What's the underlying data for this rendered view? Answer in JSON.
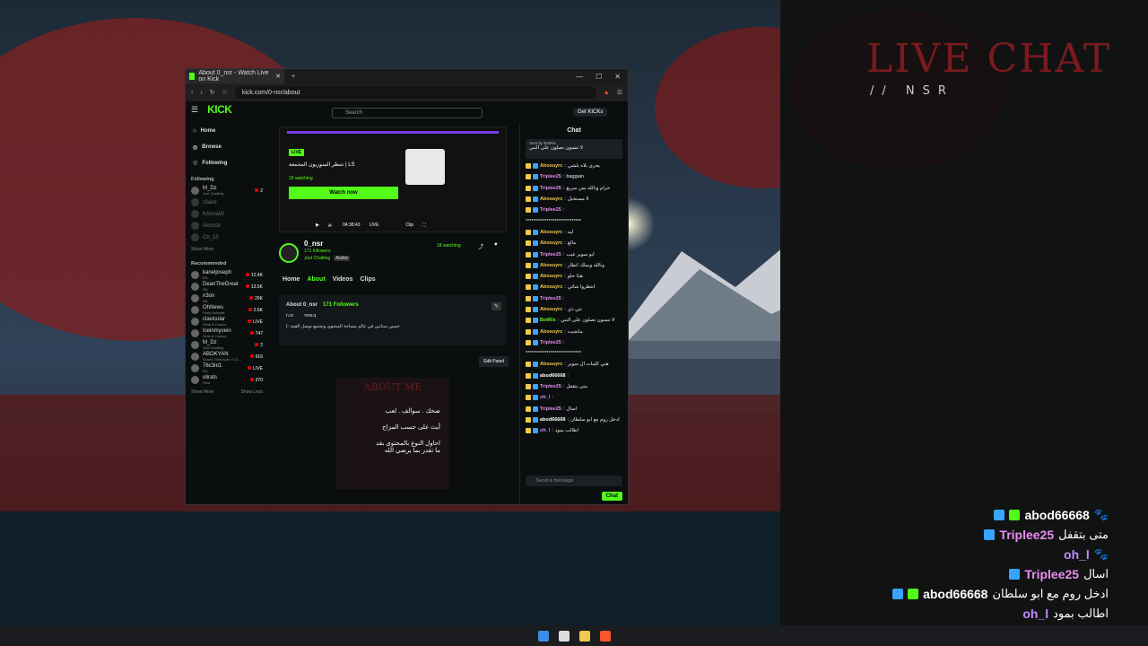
{
  "overlay": {
    "title": "LIVE CHAT",
    "subtitle": "// NSR",
    "messages": [
      {
        "user": "abod66668",
        "text": "🐾",
        "color": "#ffffff",
        "badges": [
          "#3aa3ff",
          "#53fc18"
        ]
      },
      {
        "user": "Triplee25",
        "text": "متى بتقفل",
        "color": "#e88ef0",
        "badges": [
          "#3aa3ff"
        ]
      },
      {
        "user": "oh_l",
        "text": "🐾",
        "color": "#c58af9",
        "badges": []
      },
      {
        "user": "Triplee25",
        "text": "اسال",
        "color": "#e88ef0",
        "badges": [
          "#3aa3ff"
        ]
      },
      {
        "user": "abod66668",
        "text": "ادخل روم مع ابو سلطان",
        "color": "#ffffff",
        "badges": [
          "#3aa3ff",
          "#53fc18"
        ]
      },
      {
        "user": "oh_l",
        "text": "اطالب بمود",
        "color": "#c58af9",
        "badges": []
      }
    ]
  },
  "browser": {
    "tab_title": "About 0_nsr - Watch Live on Kick",
    "new_tab": "+",
    "url": "kick.com/0-nsr/about",
    "minimize": "—",
    "maximize": "☐",
    "close": "✕"
  },
  "kick": {
    "logo": "KICK",
    "search_placeholder": "Search",
    "get_kicks": "Get KICKs",
    "nav": [
      {
        "label": "Home",
        "icon": "home-icon"
      },
      {
        "label": "Browse",
        "icon": "compass-icon"
      },
      {
        "label": "Following",
        "icon": "heart-icon"
      }
    ],
    "following_header": "Following",
    "following": [
      {
        "name": "M_Dz",
        "cat": "Just Chatting",
        "viewers": "2"
      },
      {
        "name": "Ulaire",
        "cat": "",
        "viewers": ""
      },
      {
        "name": "KAnnaW",
        "cat": "",
        "viewers": ""
      },
      {
        "name": "Alomstr",
        "cat": "",
        "viewers": ""
      },
      {
        "name": "Ch_15",
        "cat": "",
        "viewers": ""
      }
    ],
    "show_more": "Show More",
    "recommended_header": "Recommended",
    "recommended": [
      {
        "name": "kaneljoseph",
        "cat": "IRL",
        "viewers": "12.4K"
      },
      {
        "name": "DeanTheGreat",
        "cat": "IRL",
        "viewers": "13.5K"
      },
      {
        "name": "n3on",
        "cat": "IRL",
        "viewers": "29K"
      },
      {
        "name": "OhNews",
        "cat": "Party Animals",
        "viewers": "2.6K"
      },
      {
        "name": "clavicular",
        "cat": "Slots & Casino",
        "viewers": "LIVE"
      },
      {
        "name": "Iceinmyvein",
        "cat": "Slots & Casino",
        "viewers": "747"
      },
      {
        "name": "M_Dz",
        "cat": "Just Chatting",
        "viewers": "2"
      },
      {
        "name": "ABOKYAN",
        "cat": "Grand Theft Auto V (G...",
        "viewers": "916"
      },
      {
        "name": "76c3nt1",
        "cat": "IRL",
        "viewers": "LIVE"
      },
      {
        "name": "olirats",
        "cat": "Rust",
        "viewers": "370"
      }
    ],
    "show_less": "Show Less",
    "player": {
      "live_badge": "LIVE",
      "stream_title": "LS | تنتظر السوزيون المجمعة",
      "watching": "18 watching",
      "watch_now": "Watch now",
      "time": "04:38:43",
      "live_label": "LIVE",
      "clip": "Clip"
    },
    "channel": {
      "name": "0_nsr",
      "followers": "171 followers",
      "category": "Just Chatting",
      "tag": "Arabic",
      "watching": "18 watching"
    },
    "tabs": [
      "Home",
      "About",
      "Videos",
      "Clips"
    ],
    "about": {
      "title": "About 0_nsr",
      "followers": "171 Followers",
      "discord": "n.sr",
      "tiktok": "nvw.q",
      "bio": "خمس سنابتي في عالم مساحة المحتوى ونجتمع نوصل القمة :)"
    },
    "edit_panel": "Edit Panel",
    "panel": {
      "heading": "ABOUT ME",
      "line1": "ضحك . سوالف . لعب",
      "line2": "أيث على حسب المزاج",
      "line3": "احاول النوع بالمحتوى بقد",
      "line4": "ما تقدر بما يرضي الله"
    }
  },
  "chat": {
    "header": "Chat",
    "pinned_by": "Sent by BotRix",
    "pinned_text": "لا تنسون تصلون على النبي",
    "messages": [
      {
        "user": "Abosuyrc",
        "text": "يجري بلاه بلشي",
        "color": "#f2c94c"
      },
      {
        "user": "Triplee25",
        "text": "baggain",
        "color": "#e88ef0"
      },
      {
        "user": "Triplee25",
        "text": "حرام ونالله بس سريع",
        "color": "#e88ef0"
      },
      {
        "user": "Abosuyrc",
        "text": "لا مستحيل",
        "color": "#f2c94c"
      },
      {
        "user": "Triplee25",
        "text": "",
        "color": "#e88ef0"
      },
      {
        "user": "",
        "text": "*****************************",
        "color": "#eeeeee"
      },
      {
        "user": "Abosuyrc",
        "text": "ليه",
        "color": "#f2c94c"
      },
      {
        "user": "Abosuyrc",
        "text": "مالع",
        "color": "#f2c94c"
      },
      {
        "user": "Triplee25",
        "text": "ابو سوير عيب",
        "color": "#e88ef0"
      },
      {
        "user": "Abosuyrc",
        "text": "ونالله ويملك انطار",
        "color": "#f2c94c"
      },
      {
        "user": "Abosuyrc",
        "text": "هذا حلو",
        "color": "#f2c94c"
      },
      {
        "user": "Abosuyrc",
        "text": "انتظروا شائي",
        "color": "#f2c94c"
      },
      {
        "user": "Triplee25",
        "text": "",
        "color": "#e88ef0"
      },
      {
        "user": "Abosuyrc",
        "text": "تبي ذي",
        "color": "#f2c94c"
      },
      {
        "user": "BotRix",
        "text": "لا تنسون تصلون على النبي",
        "color": "#53fc18"
      },
      {
        "user": "Abosuyrc",
        "text": "مانجيت",
        "color": "#f2c94c"
      },
      {
        "user": "Triplee25",
        "text": "",
        "color": "#e88ef0"
      },
      {
        "user": "",
        "text": "*****************************",
        "color": "#eeeeee"
      },
      {
        "user": "Abosuyrc",
        "text": "هني كلمات ال سوير",
        "color": "#f2c94c"
      },
      {
        "user": "abod66668",
        "text": "",
        "color": "#ffffff"
      },
      {
        "user": "Triplee25",
        "text": "متى بتقفل",
        "color": "#e88ef0"
      },
      {
        "user": "oh_l",
        "text": "",
        "color": "#c58af9"
      },
      {
        "user": "Triplee25",
        "text": "اسال",
        "color": "#e88ef0"
      },
      {
        "user": "abod66668",
        "text": "ادخل روم مع ابو سلطان",
        "color": "#ffffff"
      },
      {
        "user": "oh_l",
        "text": "اطالب بمود",
        "color": "#c58af9"
      }
    ],
    "input_placeholder": "Send a message",
    "send": "Chat"
  }
}
